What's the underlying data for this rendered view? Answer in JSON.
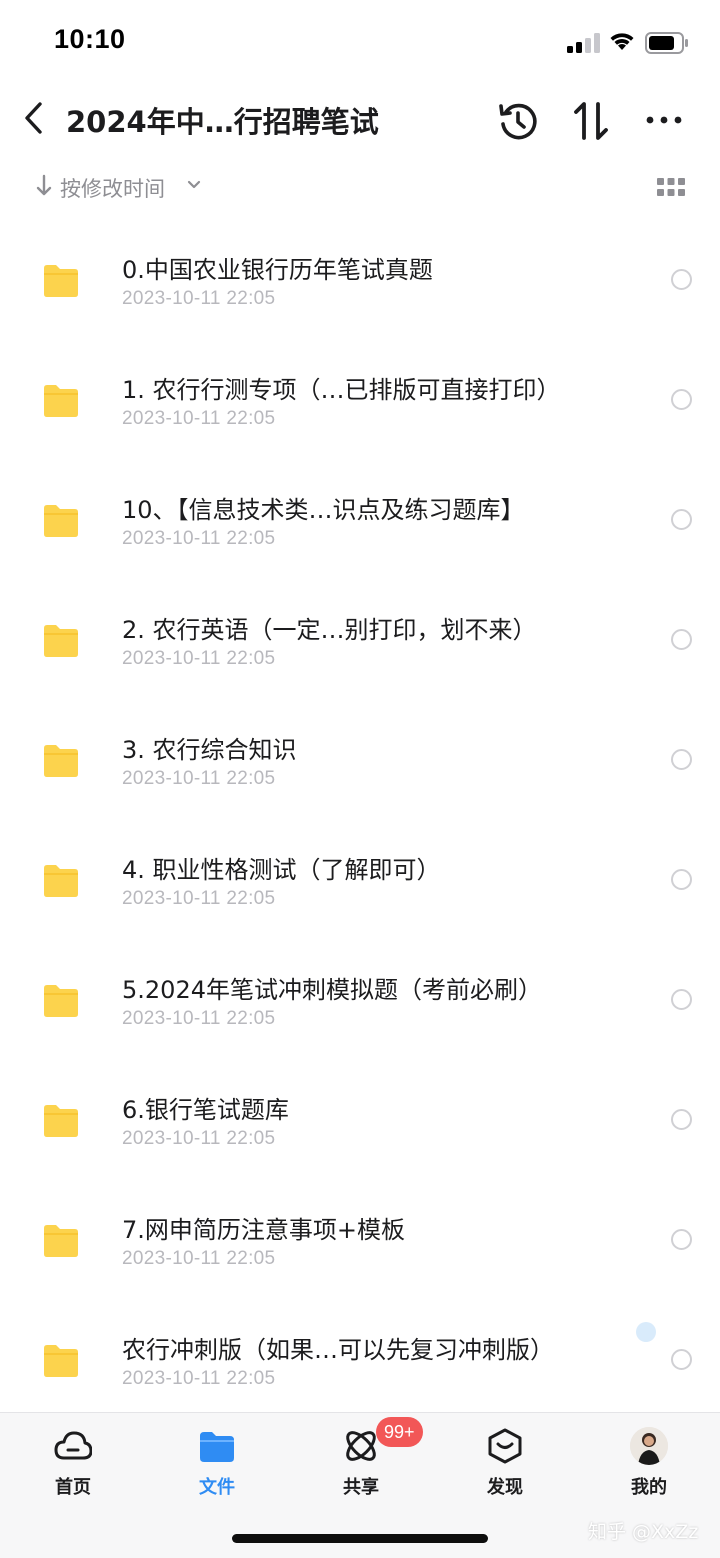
{
  "status_bar": {
    "time": "10:10"
  },
  "nav": {
    "title": "2024年中…行招聘笔试"
  },
  "sort": {
    "label": "按修改时间"
  },
  "files": [
    {
      "name": "0.中国农业银行历年笔试真题",
      "date": "2023-10-11 22:05"
    },
    {
      "name": "1. 农行行测专项（…已排版可直接打印）",
      "date": "2023-10-11 22:05"
    },
    {
      "name": "10、【信息技术类…识点及练习题库】",
      "date": "2023-10-11 22:05"
    },
    {
      "name": "2. 农行英语（一定…别打印，划不来）",
      "date": "2023-10-11 22:05"
    },
    {
      "name": "3. 农行综合知识",
      "date": "2023-10-11 22:05"
    },
    {
      "name": "4. 职业性格测试（了解即可）",
      "date": "2023-10-11 22:05"
    },
    {
      "name": "5.2024年笔试冲刺模拟题（考前必刷）",
      "date": "2023-10-11 22:05"
    },
    {
      "name": "6.银行笔试题库",
      "date": "2023-10-11 22:05"
    },
    {
      "name": "7.网申简历注意事项+模板",
      "date": "2023-10-11 22:05"
    },
    {
      "name": "农行冲刺版（如果…可以先复习冲刺版）",
      "date": "2023-10-11 22:05"
    }
  ],
  "tabs": [
    {
      "label": "首页",
      "icon": "cloud-icon"
    },
    {
      "label": "文件",
      "icon": "folder-icon",
      "active": true
    },
    {
      "label": "共享",
      "icon": "share-atom-icon",
      "badge": "99+"
    },
    {
      "label": "发现",
      "icon": "discover-icon"
    },
    {
      "label": "我的",
      "icon": "avatar"
    }
  ],
  "colors": {
    "folder": "#fcd34d",
    "accent": "#2f8cf3",
    "badge": "#f25757"
  },
  "watermark": "知乎 @XxZz"
}
